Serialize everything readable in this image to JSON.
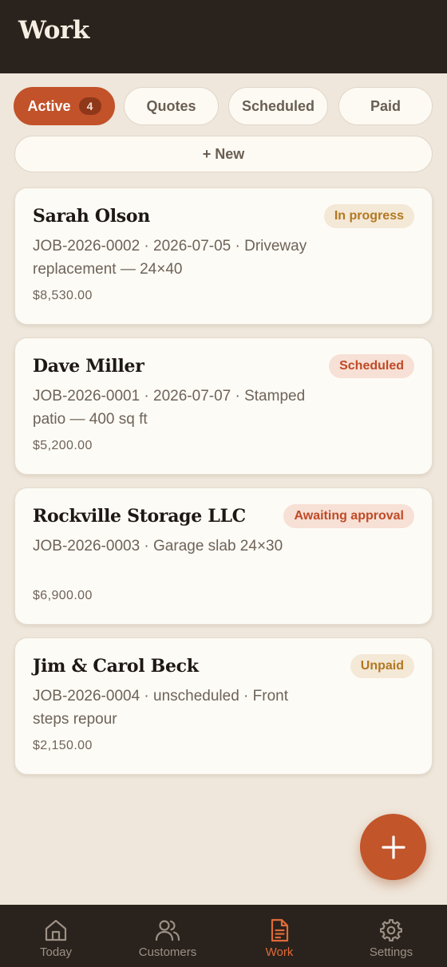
{
  "header": {
    "title": "Work"
  },
  "tabs": [
    {
      "label": "Active",
      "count": "4",
      "active": true
    },
    {
      "label": "Quotes",
      "active": false
    },
    {
      "label": "Scheduled",
      "active": false
    },
    {
      "label": "Paid",
      "active": false
    }
  ],
  "new_button": {
    "label": "+ New"
  },
  "jobs": [
    {
      "customer": "Sarah Olson",
      "details": "JOB-2026-0002 · 2026-07-05 · Driveway replacement — 24×40",
      "amount": "$8,530.00",
      "status": "In progress",
      "status_color": "#B27821",
      "status_bg": "#F4E8D6"
    },
    {
      "customer": "Dave Miller",
      "details": "JOB-2026-0001 · 2026-07-07 · Stamped patio — 400 sq ft",
      "amount": "$5,200.00",
      "status": "Scheduled",
      "status_color": "#BF4A26",
      "status_bg": "#F7E0D6"
    },
    {
      "customer": "Rockville Storage LLC",
      "details": "JOB-2026-0003 · Garage slab 24×30",
      "amount": "$6,900.00",
      "status": "Awaiting approval",
      "status_color": "#BF4A26",
      "status_bg": "#F7E0D6"
    },
    {
      "customer": "Jim & Carol Beck",
      "details": "JOB-2026-0004 · unscheduled · Front steps repour",
      "amount": "$2,150.00",
      "status": "Unpaid",
      "status_color": "#B27821",
      "status_bg": "#F4E8D6"
    }
  ],
  "fab": {
    "icon": "plus-icon"
  },
  "nav": [
    {
      "label": "Today",
      "icon": "home-icon",
      "current": false
    },
    {
      "label": "Customers",
      "icon": "users-icon",
      "current": false
    },
    {
      "label": "Work",
      "icon": "document-icon",
      "current": true
    },
    {
      "label": "Settings",
      "icon": "gear-icon",
      "current": false
    }
  ],
  "colors": {
    "accent": "#C2522A",
    "header_bg": "#2A221C",
    "page_bg": "#EFE7DB",
    "nav_active": "#E06A38",
    "nav_inactive": "#9C9186"
  }
}
